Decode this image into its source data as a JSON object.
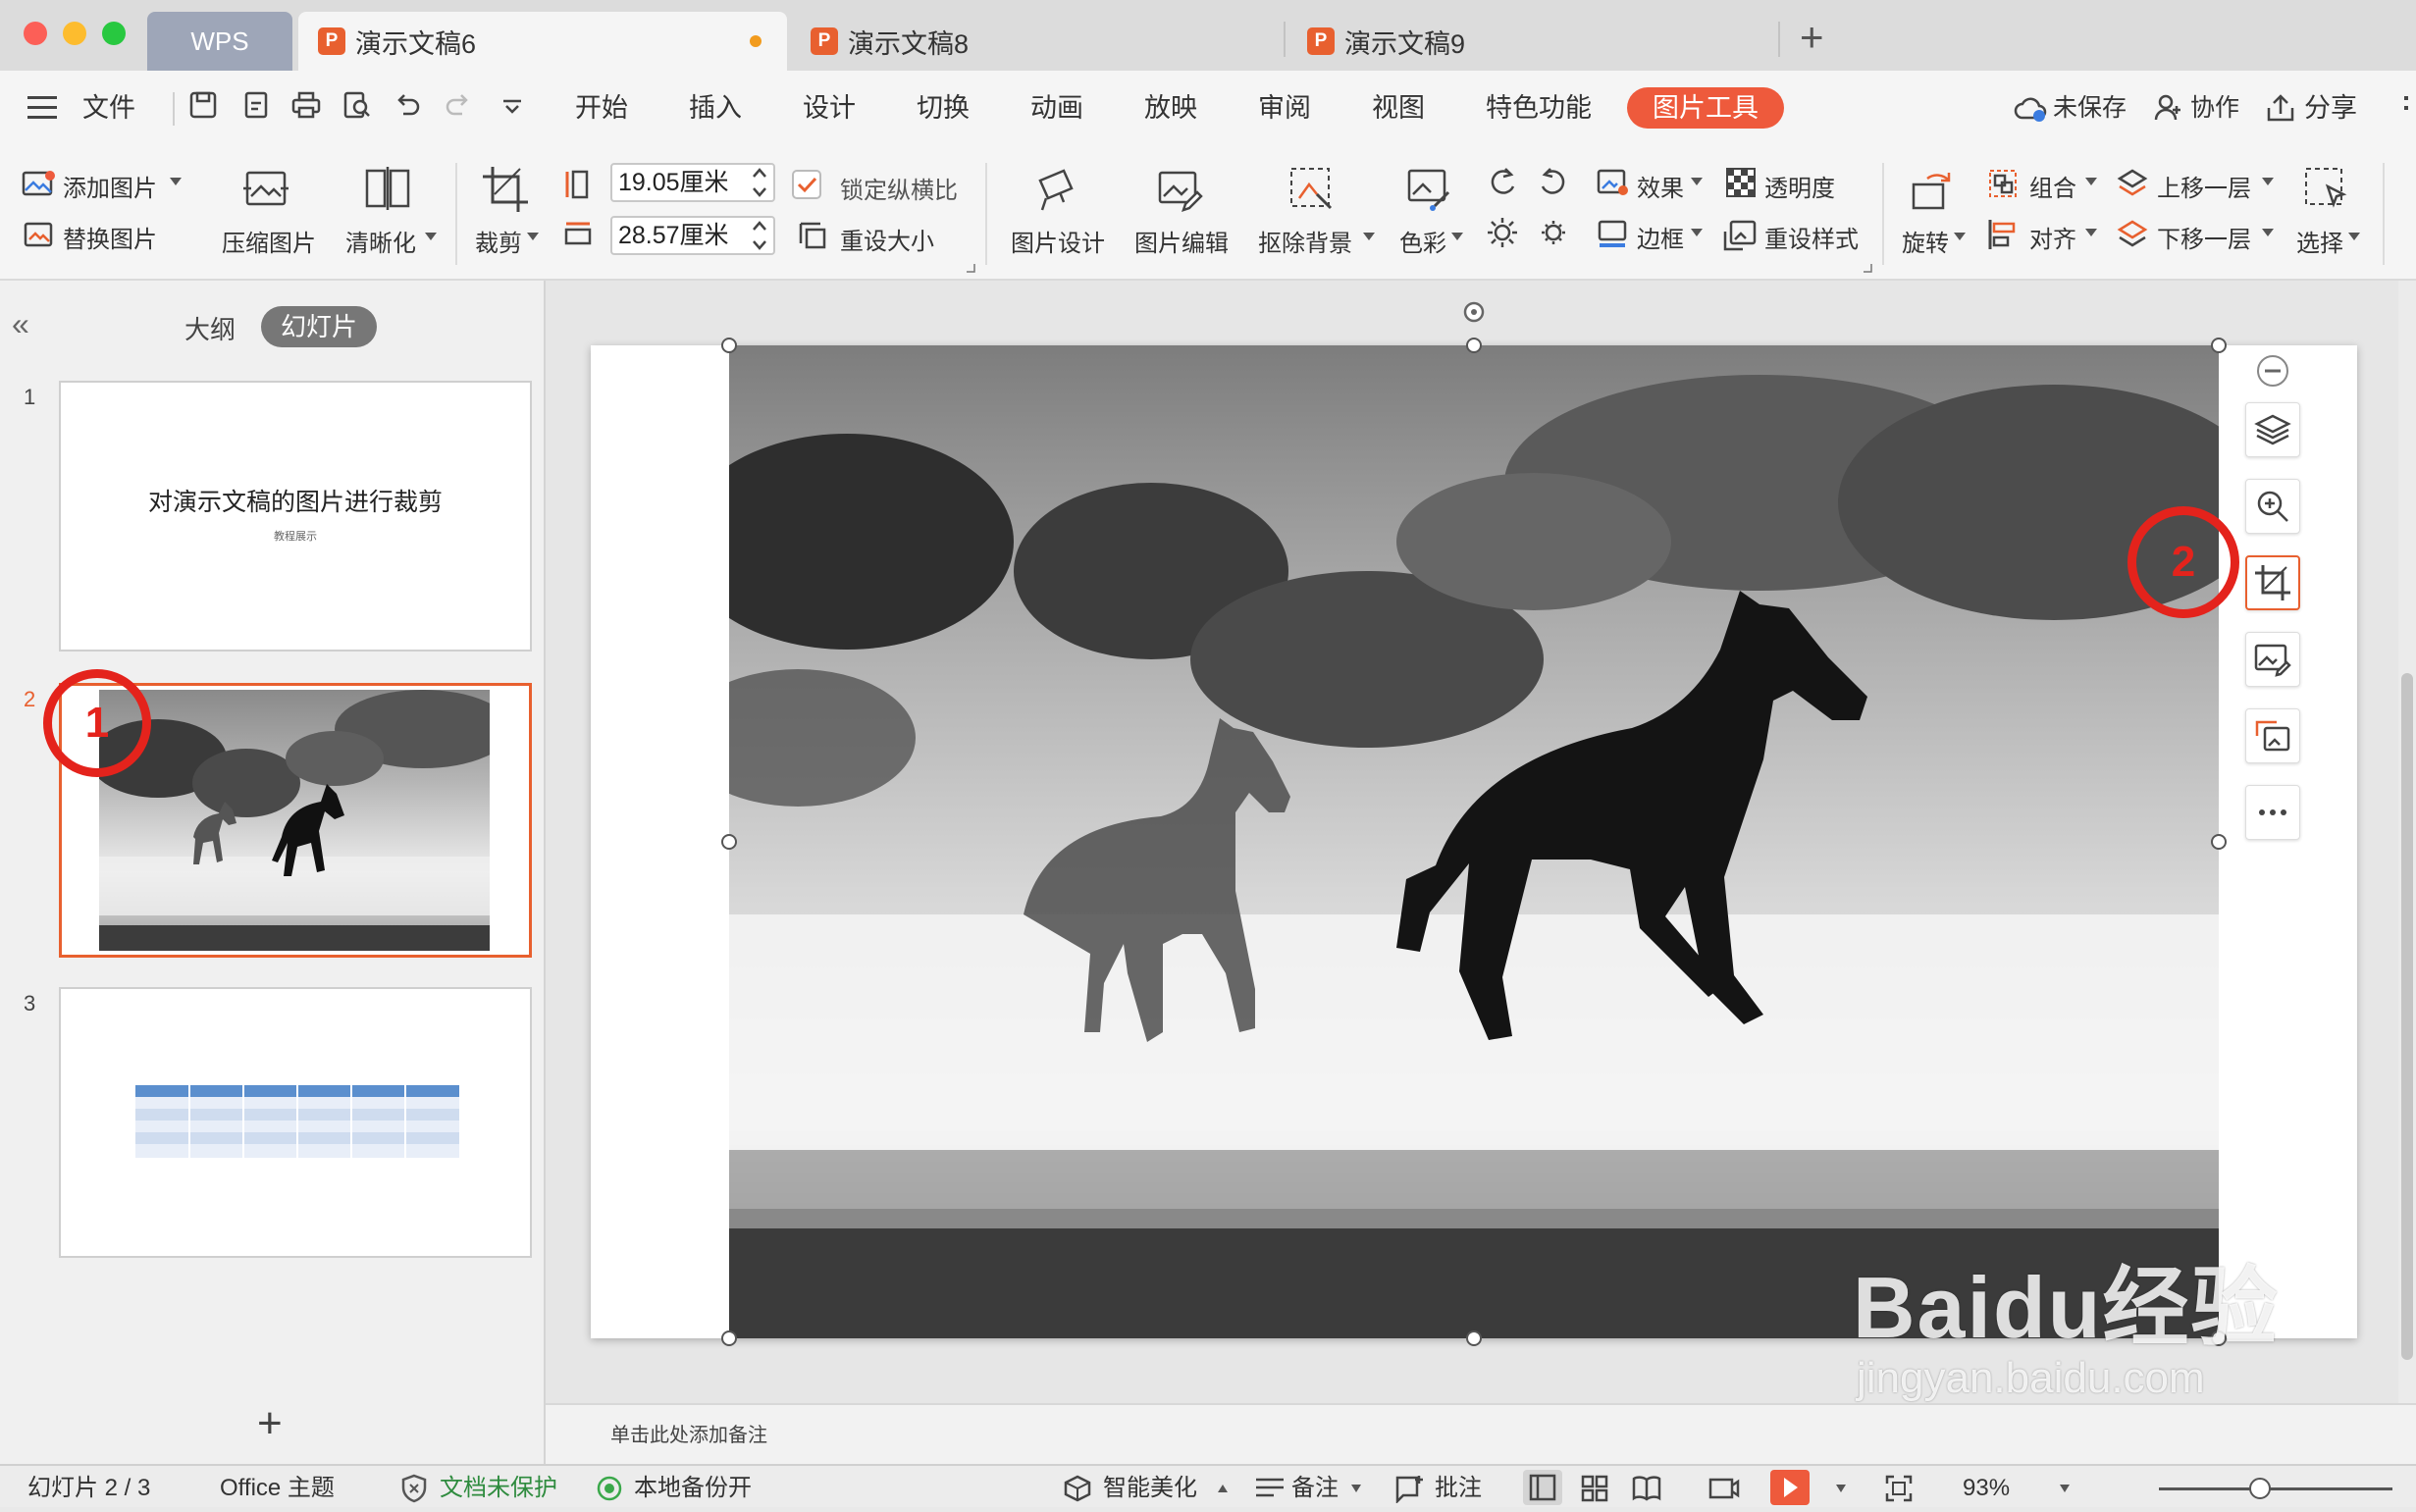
{
  "window": {
    "tabs": [
      {
        "label": "WPS"
      },
      {
        "label": "演示文稿6",
        "icon": "presentation-file-icon",
        "modified": true
      },
      {
        "label": "演示文稿8",
        "icon": "presentation-file-icon"
      },
      {
        "label": "演示文稿9",
        "icon": "presentation-file-icon"
      }
    ],
    "new_tab_label": "+"
  },
  "menubar": {
    "file_label": "文件",
    "items": [
      "开始",
      "插入",
      "设计",
      "切换",
      "动画",
      "放映",
      "审阅",
      "视图",
      "特色功能",
      "图片工具"
    ],
    "active": "图片工具",
    "right": {
      "unsaved": "未保存",
      "collaborate": "协作",
      "share": "分享"
    },
    "accent_color": "#ee5a3c"
  },
  "toolbar": {
    "add_picture": "添加图片",
    "replace_picture": "替换图片",
    "compress_picture": "压缩图片",
    "sharpen": "清晰化",
    "crop": "裁剪",
    "height_value": "19.05厘米",
    "width_value": "28.57厘米",
    "lock_ratio": "锁定纵横比",
    "reset_size": "重设大小",
    "picture_design": "图片设计",
    "picture_edit": "图片编辑",
    "remove_background": "抠除背景",
    "color": "色彩",
    "effects": "效果",
    "transparency": "透明度",
    "border": "边框",
    "reset_style": "重设样式",
    "rotate": "旋转",
    "group": "组合",
    "align": "对齐",
    "bring_forward": "上移一层",
    "send_backward": "下移一层",
    "select": "选择"
  },
  "left_panel": {
    "outline_tab": "大纲",
    "slides_tab": "幻灯片",
    "slides": [
      {
        "number": "1",
        "title": "对演示文稿的图片进行裁剪",
        "subtitle": "教程展示"
      },
      {
        "number": "2",
        "selected": true
      },
      {
        "number": "3"
      }
    ],
    "add_slide": "+"
  },
  "annotations": {
    "marker_1": "1",
    "marker_2": "2",
    "color": "#e4231c"
  },
  "notes": {
    "placeholder": "单击此处添加备注"
  },
  "statusbar": {
    "slide_info": "幻灯片 2 / 3",
    "theme": "Office 主题",
    "protect": "文档未保护",
    "backup": "本地备份开",
    "beautify": "智能美化",
    "notes": "备注",
    "comments": "批注",
    "zoom": "93%"
  },
  "watermark": {
    "brand": "Baidu经验",
    "url": "jingyan.baidu.com"
  }
}
